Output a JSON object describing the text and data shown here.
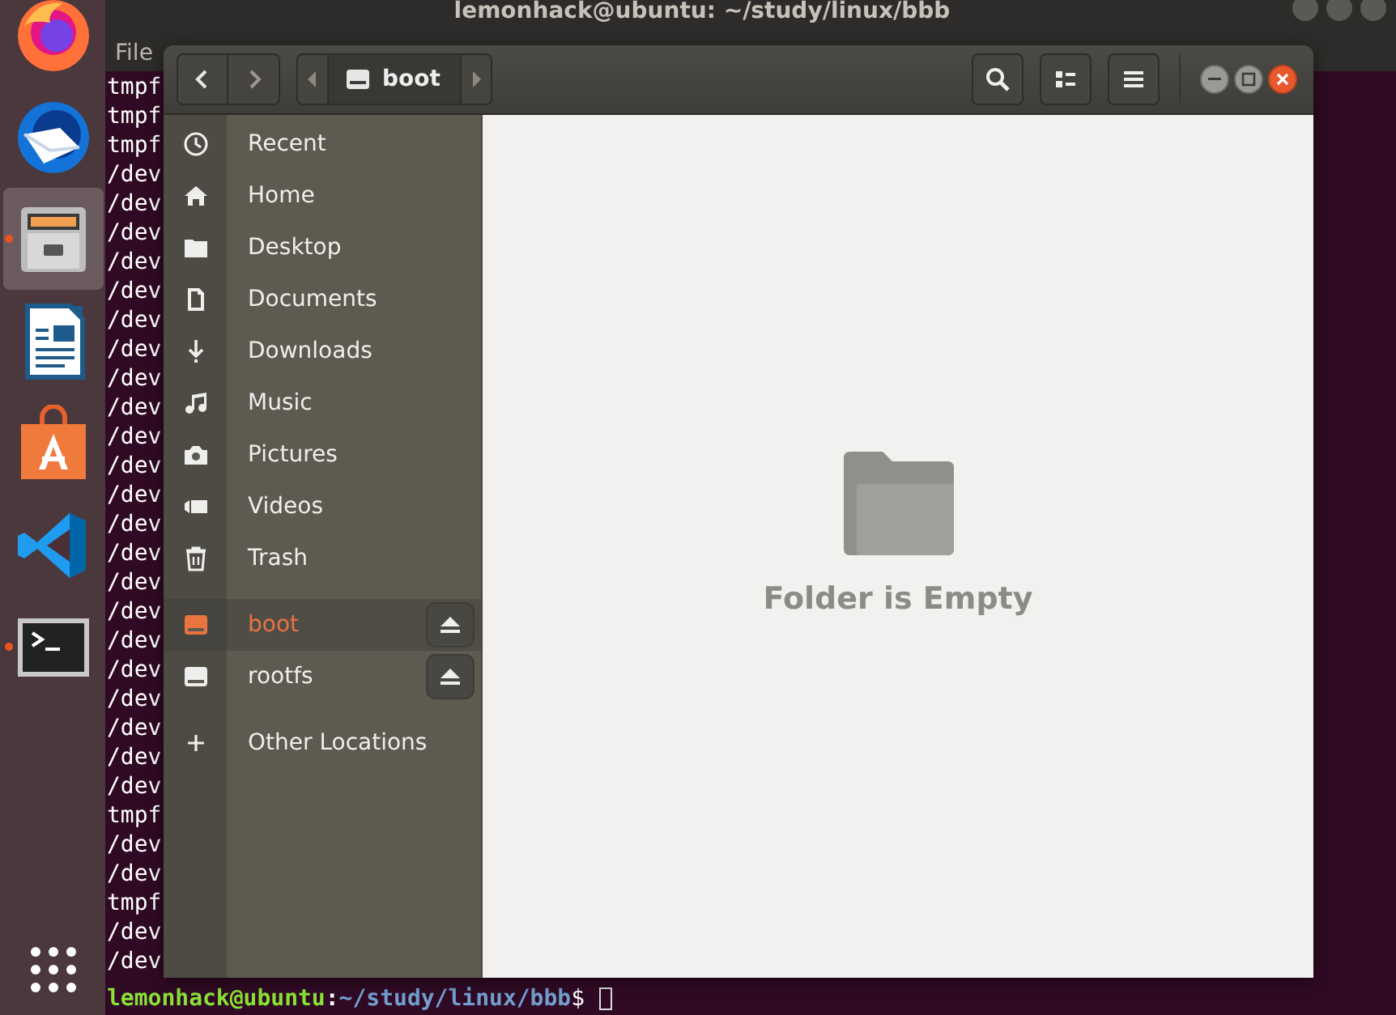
{
  "dock": {
    "apps": [
      {
        "kind": "firefox",
        "running": false,
        "selected": false
      },
      {
        "kind": "thunderbird",
        "running": false,
        "selected": false
      },
      {
        "kind": "files",
        "running": true,
        "selected": true
      },
      {
        "kind": "writer",
        "running": false,
        "selected": false
      },
      {
        "kind": "software",
        "running": false,
        "selected": false
      },
      {
        "kind": "vscode",
        "running": false,
        "selected": false
      },
      {
        "kind": "terminal",
        "running": true,
        "selected": false
      }
    ]
  },
  "terminal": {
    "title": "lemonhack@ubuntu: ~/study/linux/bbb",
    "menu": [
      "File"
    ],
    "lines": [
      "tmpf",
      "tmpf",
      "tmpf",
      "/dev",
      "/dev",
      "/dev",
      "/dev",
      "/dev",
      "/dev",
      "/dev",
      "/dev",
      "/dev",
      "/dev",
      "/dev",
      "/dev",
      "/dev",
      "/dev",
      "/dev",
      "/dev",
      "/dev",
      "/dev",
      "/dev",
      "/dev",
      "/dev",
      "/dev",
      "tmpf",
      "/dev",
      "/dev",
      "tmpf",
      "/dev",
      "/dev"
    ],
    "prompt": {
      "user_host": "lemonhack@ubuntu",
      "separator": ":",
      "path": "~/study/linux/bbb",
      "symbol": "$"
    }
  },
  "files": {
    "path_bar": {
      "current": "boot"
    },
    "sidebar": {
      "groups": [
        [
          {
            "kind": "recent",
            "label": "Recent",
            "selected": false
          },
          {
            "kind": "home",
            "label": "Home",
            "selected": false
          },
          {
            "kind": "folder",
            "label": "Desktop",
            "selected": false
          },
          {
            "kind": "document",
            "label": "Documents",
            "selected": false
          },
          {
            "kind": "download",
            "label": "Downloads",
            "selected": false
          },
          {
            "kind": "music",
            "label": "Music",
            "selected": false
          },
          {
            "kind": "camera",
            "label": "Pictures",
            "selected": false
          },
          {
            "kind": "video",
            "label": "Videos",
            "selected": false
          },
          {
            "kind": "trash",
            "label": "Trash",
            "selected": false
          }
        ],
        [
          {
            "kind": "drive",
            "label": "boot",
            "selected": true,
            "eject": true
          },
          {
            "kind": "drive",
            "label": "rootfs",
            "selected": false,
            "eject": true
          }
        ],
        [
          {
            "kind": "add",
            "label": "Other Locations",
            "selected": false
          }
        ]
      ]
    },
    "empty_message": "Folder is Empty"
  }
}
